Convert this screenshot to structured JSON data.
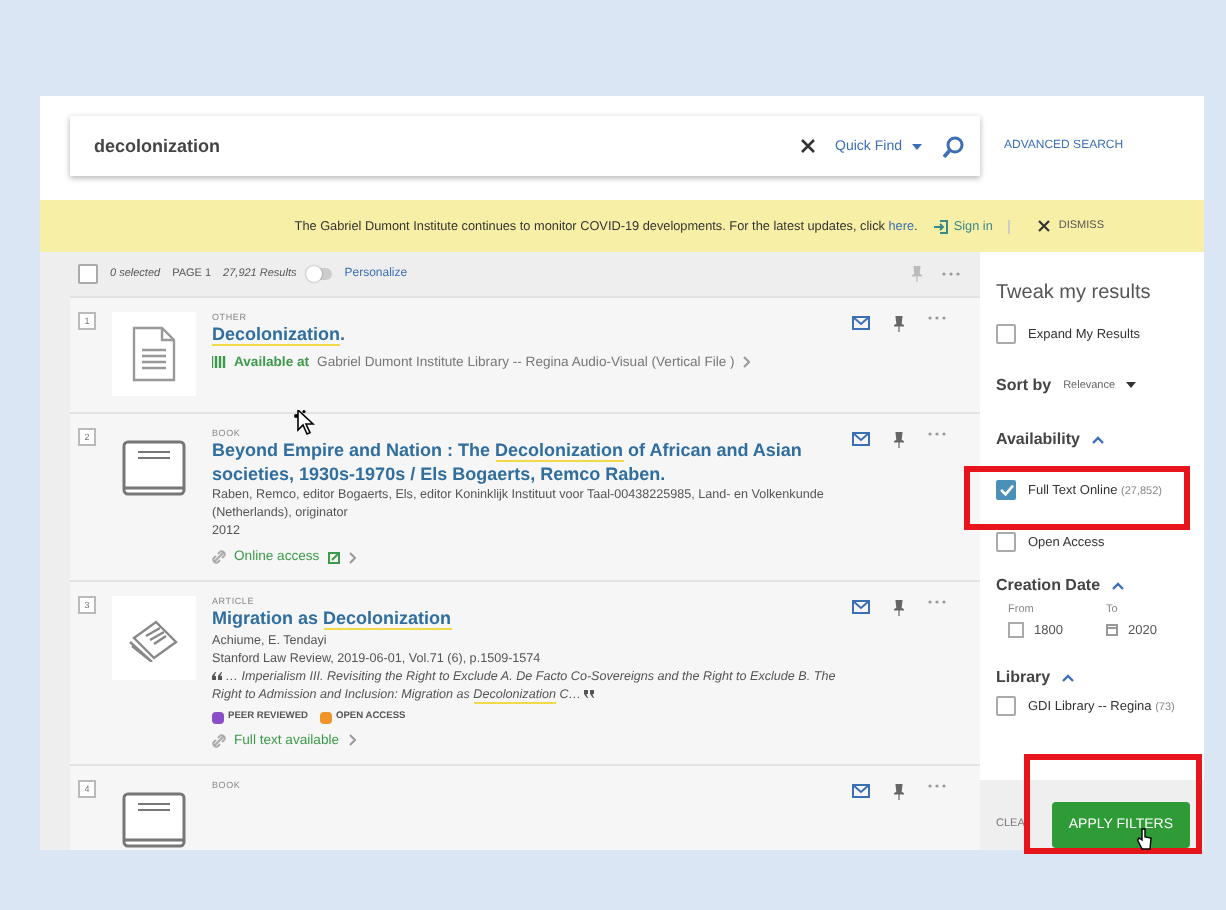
{
  "search": {
    "value": "decolonization",
    "scope": "Quick Find"
  },
  "advanced_search": "ADVANCED SEARCH",
  "banner": {
    "text": "The Gabriel Dumont Institute continues to monitor COVID-19 developments. For the latest updates, click",
    "link": "here",
    "end": ".",
    "sign_in": "Sign in",
    "dismiss": "DISMISS"
  },
  "toolbar": {
    "select_all": {
      "checked": false
    },
    "selected": "0 selected",
    "page": "PAGE 1",
    "results": "27,921 Results",
    "personalize": {
      "label": "Personalize",
      "on": false
    }
  },
  "results": [
    {
      "number": "1",
      "type": "OTHER",
      "kind": "document",
      "title": [
        {
          "text": "Decolonization",
          "highlight": true
        },
        {
          "text": ".",
          "highlight": false
        }
      ],
      "availability": {
        "status": "Available at",
        "location": "Gabriel Dumont Institute Library -- Regina  Audio-Visual (Vertical File )"
      }
    },
    {
      "number": "2",
      "type": "BOOK",
      "kind": "book",
      "title": [
        {
          "text": "Beyond Empire and Nation : The ",
          "highlight": false
        },
        {
          "text": "Decolonization",
          "highlight": true
        },
        {
          "text": " of African and Asian societies, 1930s-1970s / Els Bogaerts, Remco Raben.",
          "highlight": false
        }
      ],
      "lines": [
        "Raben, Remco, editor Bogaerts, Els, editor Koninklijk Instituut voor Taal-00438225985, Land- en Volkenkunde (Netherlands), originator",
        "2012"
      ],
      "link": {
        "text": "Online access",
        "external": true
      }
    },
    {
      "number": "3",
      "type": "ARTICLE",
      "kind": "article",
      "title": [
        {
          "text": "Migration as ",
          "highlight": false
        },
        {
          "text": "Decolonization",
          "highlight": true
        }
      ],
      "lines": [
        "Achiume, E. Tendayi",
        "Stanford Law Review, 2019-06-01, Vol.71 (6), p.1509-1574"
      ],
      "snippet": [
        {
          "text": "… Imperialism III. Revisiting the Right to Exclude A. De Facto Co-Sovereigns and the Right to Exclude B. The Right to Admission and Inclusion: Migration as ",
          "highlight": false
        },
        {
          "text": "Decolonization",
          "highlight": true
        },
        {
          "text": " C…",
          "highlight": false
        }
      ],
      "badges": [
        {
          "text": "PEER REVIEWED",
          "color": "#8a4fc8"
        },
        {
          "text": "OPEN ACCESS",
          "color": "#f0932b"
        }
      ],
      "link": {
        "text": "Full text available",
        "external": false
      }
    },
    {
      "number": "4",
      "type": "BOOK",
      "kind": "book"
    }
  ],
  "sidebar": {
    "title": "Tweak my results",
    "expand": {
      "label": "Expand My Results",
      "checked": false
    },
    "sort": {
      "label": "Sort by",
      "value": "Relevance"
    },
    "sections": [
      {
        "title": "Availability",
        "expanded": true,
        "kind": "checklist",
        "options": [
          {
            "label": "Full Text Online",
            "count": "(27,852)",
            "checked": true,
            "gap_before": true
          },
          {
            "label": "Open Access",
            "checked": false,
            "gap_before": true
          }
        ]
      },
      {
        "title": "Creation Date",
        "expanded": true,
        "kind": "range",
        "from_label": "From",
        "to_label": "To",
        "from": "1800",
        "to": "2020"
      },
      {
        "title": "Library",
        "expanded": true,
        "kind": "checklist",
        "options": [
          {
            "label": "GDI Library -- Regina",
            "count": "(73)",
            "checked": false,
            "gap_before": false
          }
        ]
      }
    ]
  },
  "footer": {
    "clear": "CLEA",
    "apply": "APPLY FILTERS"
  }
}
